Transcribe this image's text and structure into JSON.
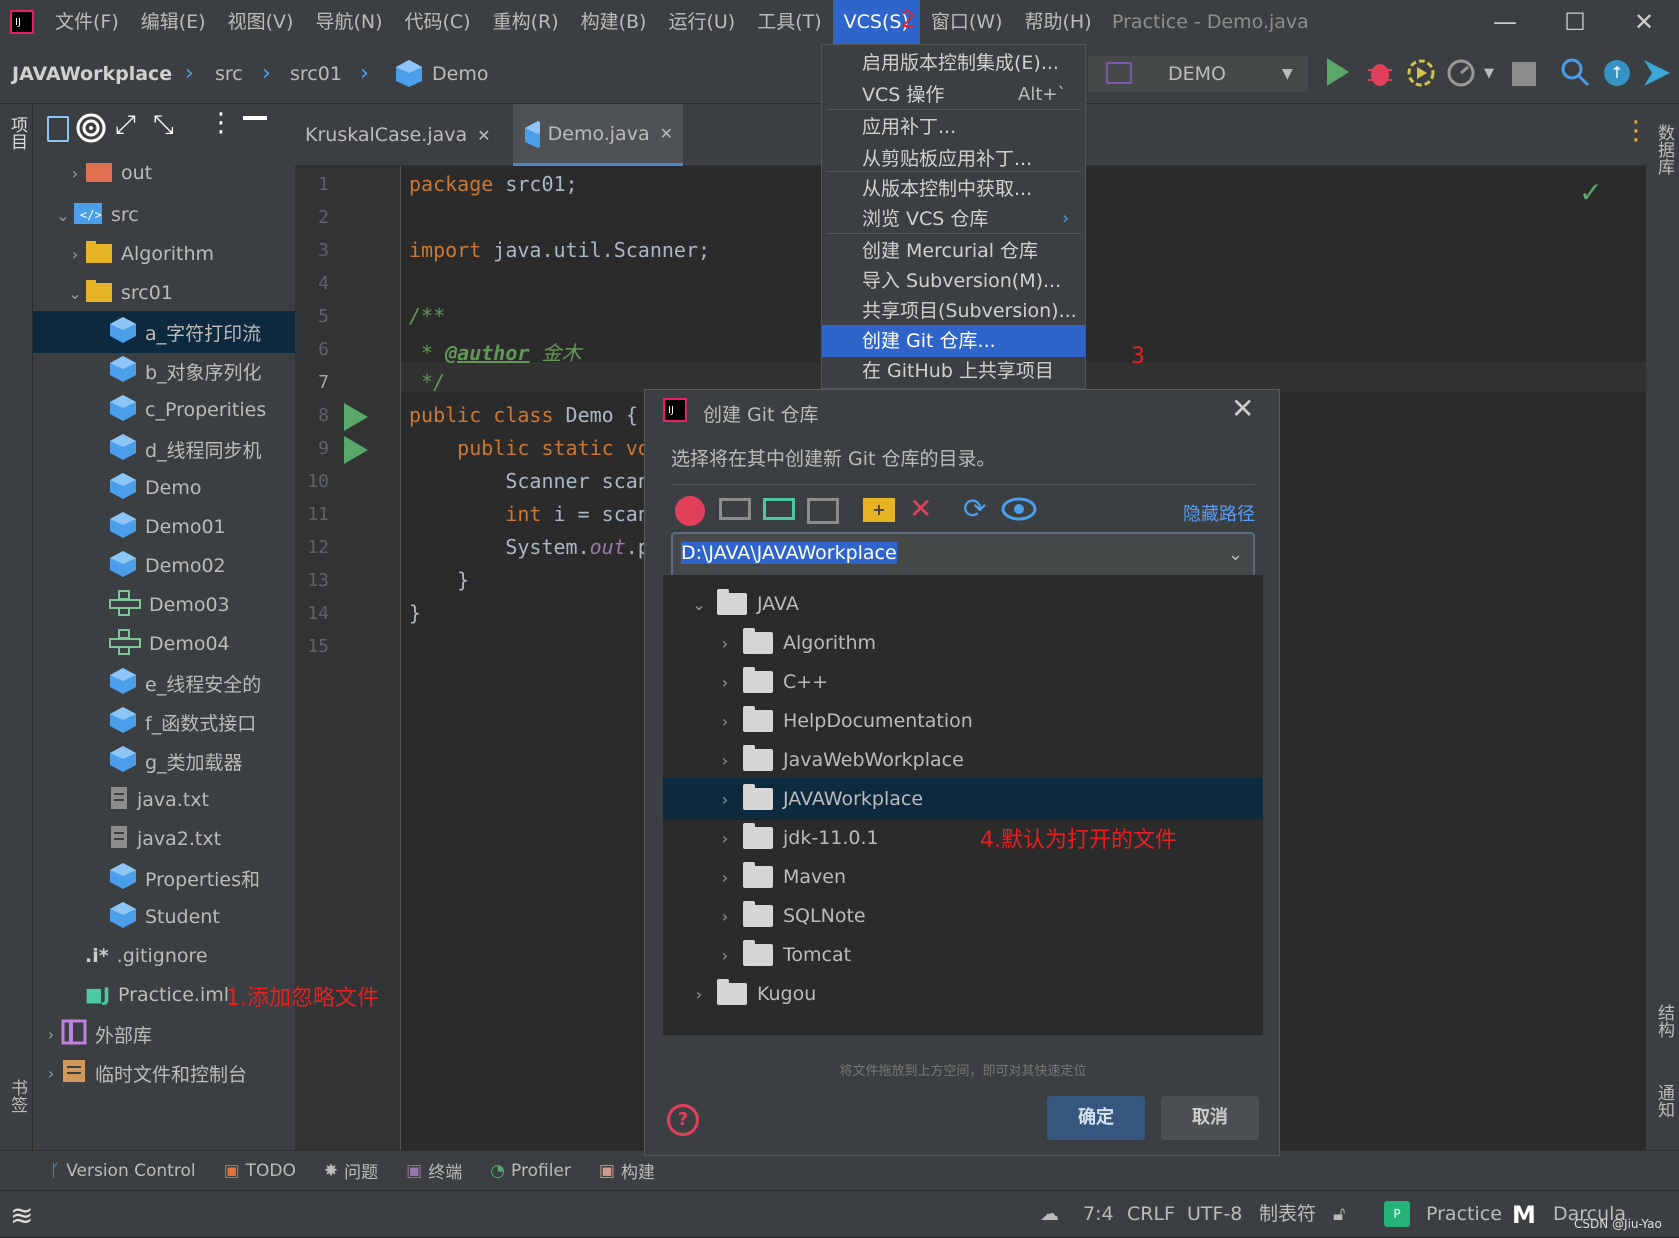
{
  "menubar": {
    "items": [
      "文件(F)",
      "编辑(E)",
      "视图(V)",
      "导航(N)",
      "代码(C)",
      "重构(R)",
      "构建(B)",
      "运行(U)",
      "工具(T)",
      "VCS(S)",
      "窗口(W)",
      "帮助(H)"
    ],
    "window_title": "Practice - Demo.java"
  },
  "navbar": {
    "project": "JAVAWorkplace",
    "crumbs": [
      "src",
      "src01",
      "Demo"
    ],
    "run_config": "DEMO"
  },
  "project_tree": {
    "rows": [
      {
        "label": "out"
      },
      {
        "label": "src"
      },
      {
        "label": "Algorithm"
      },
      {
        "label": "src01"
      },
      {
        "label": "a_字符打印流"
      },
      {
        "label": "b_对象序列化"
      },
      {
        "label": "c_Properities"
      },
      {
        "label": "d_线程同步机"
      },
      {
        "label": "Demo"
      },
      {
        "label": "Demo01"
      },
      {
        "label": "Demo02"
      },
      {
        "label": "Demo03"
      },
      {
        "label": "Demo04"
      },
      {
        "label": "e_线程安全的"
      },
      {
        "label": "f_函数式接口"
      },
      {
        "label": "g_类加载器"
      },
      {
        "label": "java.txt"
      },
      {
        "label": "java2.txt"
      },
      {
        "label": "Properties和"
      },
      {
        "label": "Student"
      },
      {
        "label": ".gitignore"
      },
      {
        "label": "Practice.iml"
      },
      {
        "label": "外部库"
      },
      {
        "label": "临时文件和控制台"
      }
    ]
  },
  "side_labels": {
    "project": "项目",
    "bookmarks": "书签",
    "database": "数据库",
    "structure": "结构",
    "notifications": "通知"
  },
  "editor": {
    "tabs": [
      "KruskalCase.java",
      "Demo.java"
    ],
    "lines": [
      "1",
      "2",
      "3",
      "4",
      "5",
      "6",
      "7",
      "8",
      "9",
      "10",
      "11",
      "12",
      "13",
      "14",
      "15"
    ],
    "code": {
      "l1a": "package",
      "l1b": " src01;",
      "l3a": "import",
      "l3b": " java.util.Scanner;",
      "l5": "/**",
      "l6a": " * ",
      "l6b": "@author",
      "l6c": " 金木",
      "l7": " */",
      "l8a": "public class",
      "l8b": " Demo {",
      "l9a": "    public static vo",
      "l10": "        Scanner scan",
      "l11a": "        int",
      "l11b": " i = scan",
      "l12a": "        System.",
      "l12b": "out",
      "l12c": ".p",
      "l13": "    }",
      "l14": "}"
    }
  },
  "vcs_menu": {
    "items": [
      "启用版本控制集成(E)...",
      "VCS 操作",
      "应用补丁...",
      "从剪贴板应用补丁...",
      "从版本控制中获取...",
      "浏览 VCS 仓库",
      "创建 Mercurial 仓库",
      "导入 Subversion(M)...",
      "共享项目(Subversion)...",
      "创建 Git 仓库...",
      "在 GitHub 上共享项目"
    ],
    "shortcut": "Alt+`"
  },
  "annotations": {
    "a1": "1.添加忽略文件",
    "a2": "2",
    "a3": "3",
    "a4": "4.默认为打开的文件"
  },
  "dialog": {
    "title": "创建 Git 仓库",
    "description": "选择将在其中创建新 Git 仓库的目录。",
    "hide_path": "隐藏路径",
    "path": "D:\\JAVA\\JAVAWorkplace",
    "tree": [
      "JAVA",
      "Algorithm",
      "C++",
      "HelpDocumentation",
      "JavaWebWorkplace",
      "JAVAWorkplace",
      "jdk-11.0.1",
      "Maven",
      "SQLNote",
      "Tomcat",
      "Kugou"
    ],
    "drop_hint": "将文件拖放到上方空间，即可对其快速定位",
    "ok": "确定",
    "cancel": "取消"
  },
  "bottom_tabs": [
    "Version Control",
    "TODO",
    "问题",
    "终端",
    "Profiler",
    "构建"
  ],
  "status": {
    "pos": "7:4",
    "eol": "CRLF",
    "encoding": "UTF-8",
    "indent": "制表符",
    "project": "Practice",
    "theme": "Darcula",
    "watermark": "CSDN @Jiu-Yao"
  },
  "colors": {
    "accent": "#2f65ca",
    "red_annotation": "#e62020",
    "run_green": "#59a869"
  }
}
